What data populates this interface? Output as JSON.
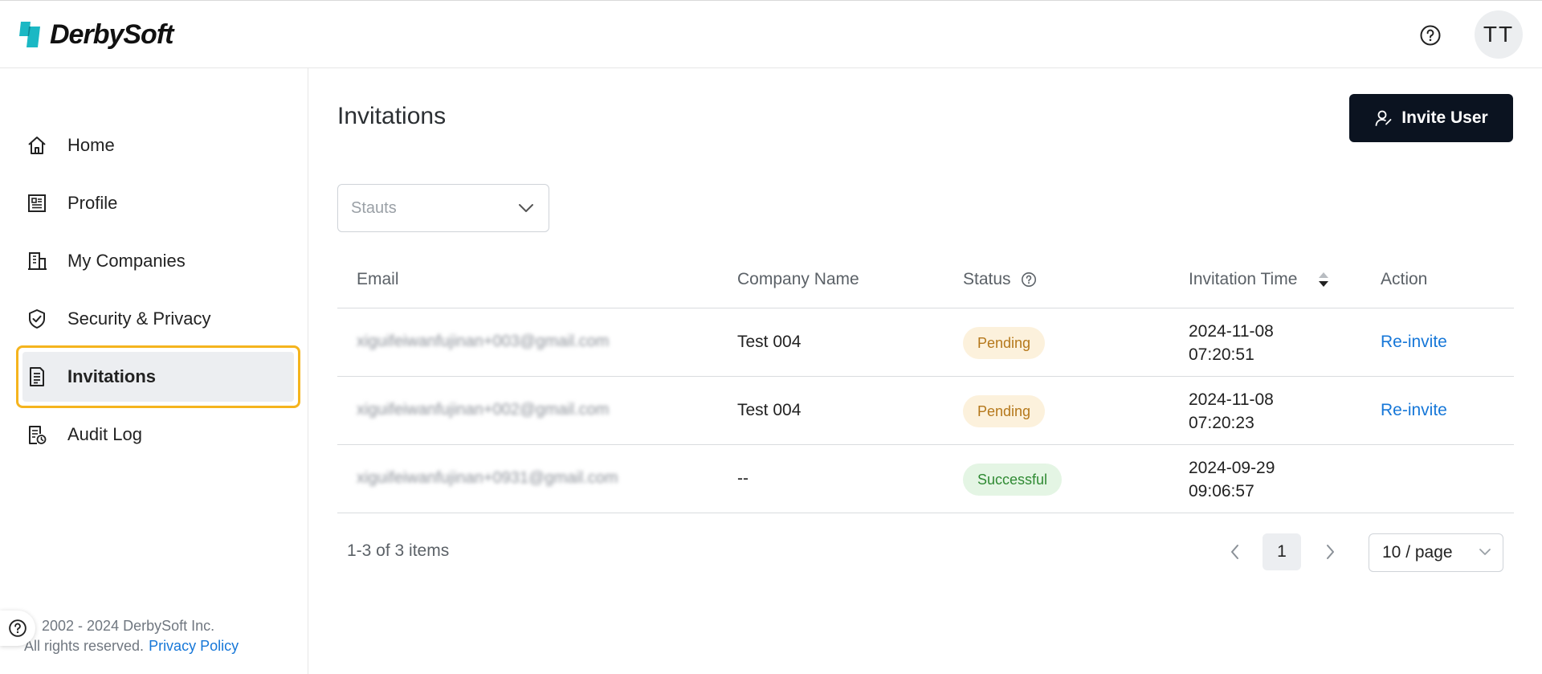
{
  "header": {
    "logo_text": "DerbySoft",
    "avatar_initials": "TT",
    "help_icon": "question-circle-icon"
  },
  "sidebar": {
    "items": [
      {
        "label": "Home",
        "icon": "home-icon"
      },
      {
        "label": "Profile",
        "icon": "profile-card-icon"
      },
      {
        "label": "My Companies",
        "icon": "building-icon"
      },
      {
        "label": "Security & Privacy",
        "icon": "shield-check-icon"
      },
      {
        "label": "Invitations",
        "icon": "document-list-icon",
        "active": true
      },
      {
        "label": "Audit Log",
        "icon": "audit-log-icon"
      }
    ],
    "footer": {
      "copyright": "2002 - 2024 DerbySoft Inc.",
      "rights": "All rights reserved.",
      "privacy_link": "Privacy Policy"
    }
  },
  "main": {
    "title": "Invitations",
    "invite_button": "Invite User",
    "status_filter": {
      "placeholder": "Stauts"
    },
    "table": {
      "columns": {
        "email": "Email",
        "company": "Company Name",
        "status": "Status",
        "time": "Invitation Time",
        "action": "Action"
      },
      "rows": [
        {
          "email": "xiguifeiwanfujinan+003@gmail.com",
          "company": "Test 004",
          "status": "Pending",
          "date": "2024-11-08",
          "time": "07:20:51",
          "action": "Re-invite"
        },
        {
          "email": "xiguifeiwanfujinan+002@gmail.com",
          "company": "Test 004",
          "status": "Pending",
          "date": "2024-11-08",
          "time": "07:20:23",
          "action": "Re-invite"
        },
        {
          "email": "xiguifeiwanfujinan+0931@gmail.com",
          "company": "--",
          "status": "Successful",
          "date": "2024-09-29",
          "time": "09:06:57",
          "action": ""
        }
      ]
    },
    "pagination": {
      "summary": "1-3 of 3 items",
      "current_page": "1",
      "page_size": "10 / page"
    }
  },
  "colors": {
    "accent_link": "#1677d8",
    "active_outline": "#f5b41e",
    "primary_button": "#0b1320",
    "logo_teal": "#1bb8c4"
  }
}
